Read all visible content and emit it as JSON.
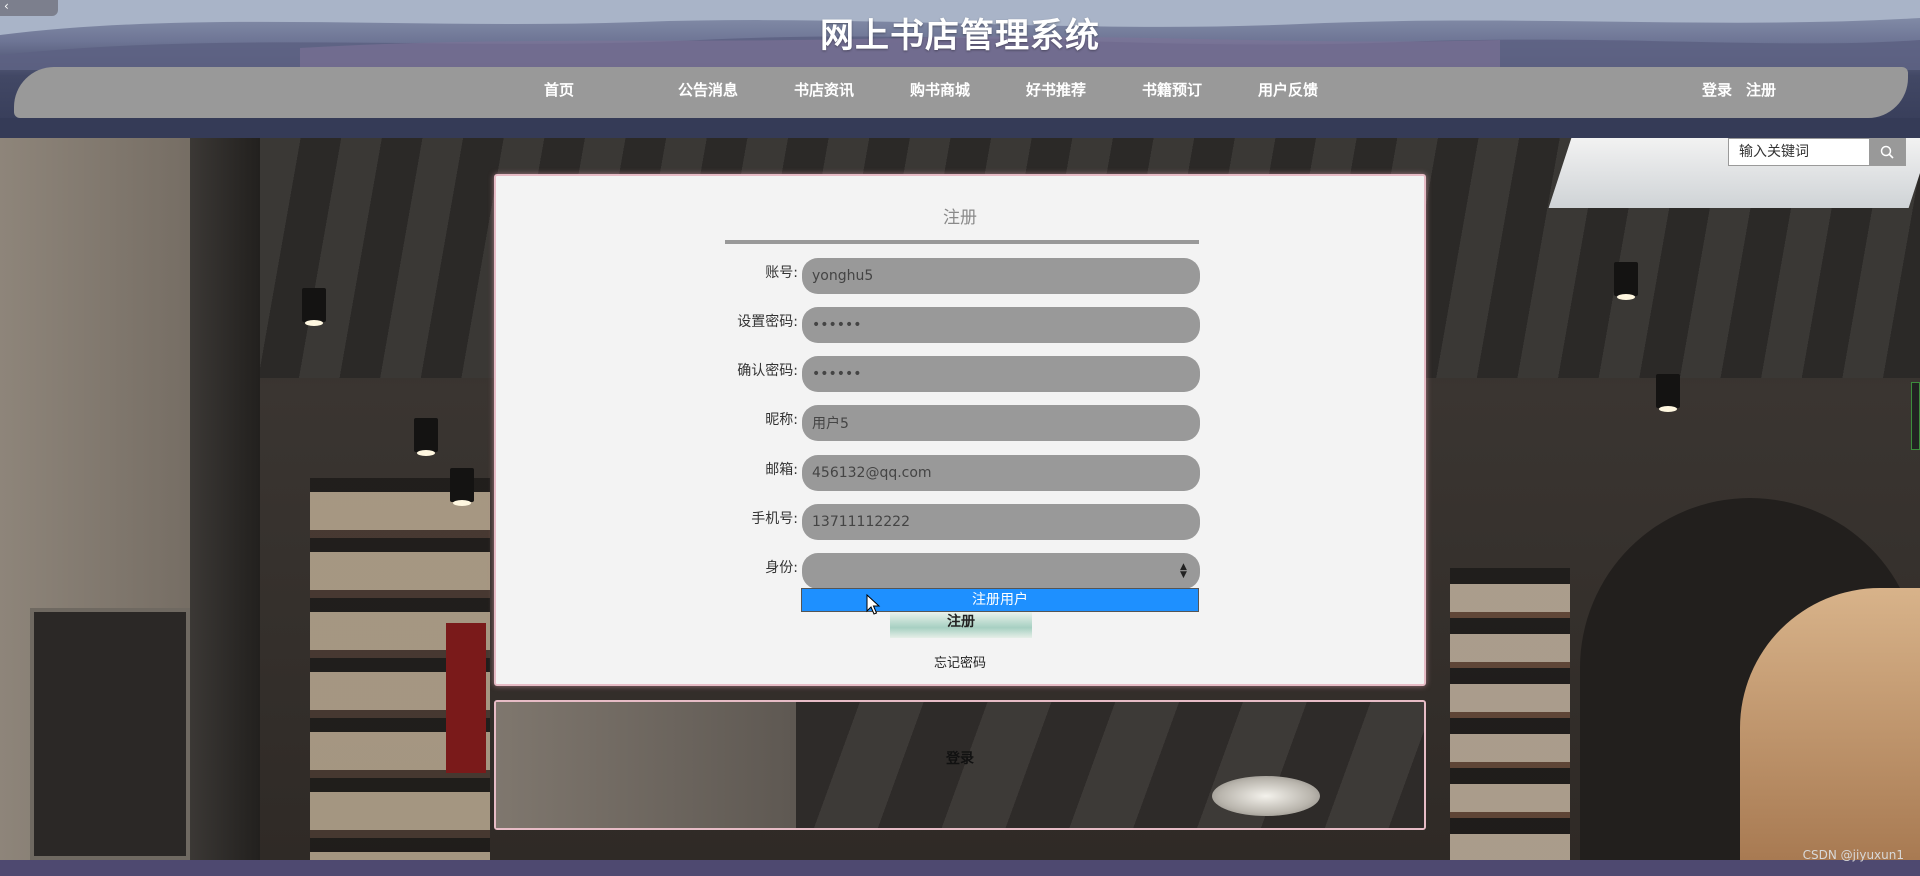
{
  "header": {
    "title": "网上书店管理系统"
  },
  "nav": {
    "items": [
      {
        "label": "首页"
      },
      {
        "label": "公告消息"
      },
      {
        "label": "书店资讯"
      },
      {
        "label": "购书商城"
      },
      {
        "label": "好书推荐"
      },
      {
        "label": "书籍预订"
      },
      {
        "label": "用户反馈"
      }
    ],
    "login": "登录",
    "register": "注册"
  },
  "search": {
    "placeholder": "输入关键词"
  },
  "register_form": {
    "title": "注册",
    "fields": [
      {
        "label": "账号:",
        "value": "yonghu5"
      },
      {
        "label": "设置密码:",
        "value": "••••••"
      },
      {
        "label": "确认密码:",
        "value": "••••••"
      },
      {
        "label": "昵称:",
        "value": "用户5"
      },
      {
        "label": "邮箱:",
        "value": "456132@qq.com"
      },
      {
        "label": "手机号:",
        "value": "13711112222"
      },
      {
        "label": "身份:",
        "value": ""
      }
    ],
    "dropdown_option": "注册用户",
    "submit": "注册",
    "forgot": "忘记密码"
  },
  "login_panel": {
    "link": "登录"
  },
  "watermark": "CSDN @jiyuxun1"
}
